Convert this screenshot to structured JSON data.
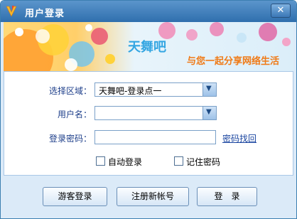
{
  "window": {
    "title": "用户登录",
    "close_glyph": "✕"
  },
  "banner": {
    "brand": "天舞吧",
    "slogan": "与您一起分享网络生活"
  },
  "form": {
    "region_label": "选择区域：",
    "region_value": "天舞吧-登录点一",
    "username_label": "用户名：",
    "username_value": "",
    "password_label": "登录密码：",
    "password_value": "",
    "recover_link": "密码找回",
    "auto_login_label": "自动登录",
    "remember_label": "记住密码",
    "dropdown_glyph": "▼"
  },
  "buttons": {
    "guest": "游客登录",
    "register": "注册新帐号",
    "login": "登　录"
  },
  "colors": {
    "titlebar": "#3a7bbd",
    "label_text": "#1e3f8a",
    "slogan": "#f07a16",
    "brand": "#34a6e2"
  },
  "icons": {
    "app_logo": "app-logo-icon",
    "dropdown": "chevron-down-icon",
    "close": "close-icon"
  }
}
